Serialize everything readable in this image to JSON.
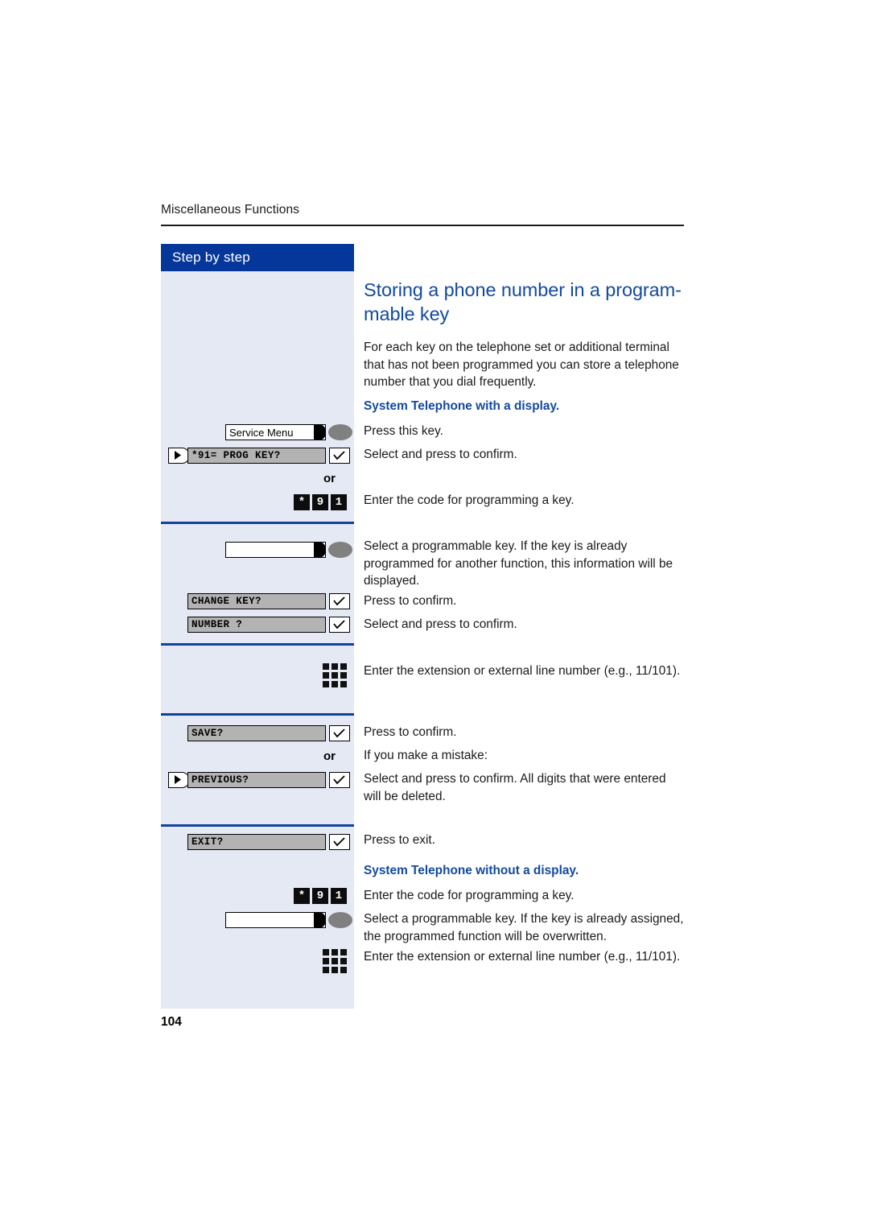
{
  "page": {
    "running_head": "Miscellaneous Functions",
    "folio": "104"
  },
  "sidebar": {
    "header_label": "Step by step",
    "sections": [
      {
        "name": "service-menu-section",
        "rows": [
          {
            "type": "function-key",
            "name": "service-menu-key",
            "label": "Service Menu"
          },
          {
            "type": "display-line",
            "name": "prog-key-display-line",
            "has_arrow": true,
            "text": "*91= PROG KEY?",
            "confirm": true
          },
          {
            "type": "or",
            "name": "or-marker-1",
            "label": "or"
          },
          {
            "type": "dial-keys",
            "name": "code-91-keys",
            "keys": [
              "*",
              "9",
              "1"
            ]
          }
        ]
      },
      {
        "name": "select-key-section",
        "rows": [
          {
            "type": "function-key",
            "name": "programmable-key",
            "label": ""
          },
          {
            "type": "display-line",
            "name": "change-key-display-line",
            "has_arrow": false,
            "text": "CHANGE KEY?",
            "confirm": true
          },
          {
            "type": "display-line",
            "name": "number-display-line",
            "has_arrow": false,
            "text": "NUMBER ?",
            "confirm": true
          }
        ]
      },
      {
        "name": "enter-number-section",
        "rows": [
          {
            "type": "keypad",
            "name": "keypad-icon"
          }
        ]
      },
      {
        "name": "save-section",
        "rows": [
          {
            "type": "display-line",
            "name": "save-display-line",
            "has_arrow": false,
            "text": "SAVE?",
            "confirm": true
          },
          {
            "type": "or",
            "name": "or-marker-2",
            "label": "or"
          },
          {
            "type": "display-line",
            "name": "previous-display-line",
            "has_arrow": true,
            "text": "PREVIOUS?",
            "confirm": true
          }
        ]
      },
      {
        "name": "exit-section",
        "rows": [
          {
            "type": "display-line",
            "name": "exit-display-line",
            "has_arrow": false,
            "text": "EXIT?",
            "confirm": true
          },
          {
            "type": "dial-keys",
            "name": "code-91-keys-2",
            "keys": [
              "*",
              "9",
              "1"
            ]
          },
          {
            "type": "function-key",
            "name": "programmable-key-2",
            "label": ""
          },
          {
            "type": "keypad",
            "name": "keypad-icon-2"
          }
        ]
      }
    ],
    "lcd_texts": {
      "prog_key": "*91= PROG KEY?",
      "change_key": "CHANGE KEY?",
      "number": "NUMBER ?",
      "save": "SAVE?",
      "previous": "PREVIOUS?",
      "exit": "EXIT?"
    },
    "service_menu_label": "Service Menu",
    "or_label": "or",
    "dial_keys": {
      "star": "*",
      "nine": "9",
      "one": "1"
    }
  },
  "content": {
    "title": "Storing a phone number in a program-\nmable key",
    "intro": "For each key on the telephone set or additional terminal that has not been programmed you can store a telephone number that you dial frequently.",
    "subhead_with_display": "System Telephone with a display.",
    "subhead_without_display": "System Telephone without a display.",
    "steps": {
      "press_this_key": "Press this key.",
      "select_confirm_1": "Select and press to confirm.",
      "enter_code": "Enter the code for programming a key.",
      "select_prog_key": "Select a programmable key. If the key is already programmed for another function, this information will be displayed.",
      "press_confirm_1": "Press to confirm.",
      "select_confirm_2": "Select and press to confirm.",
      "enter_extension_1": "Enter the extension or external line number (e.g., 11/101).",
      "press_confirm_2": "Press to confirm.",
      "if_mistake": "If you make a mistake:",
      "select_confirm_delete": "Select and press to confirm. All digits that were entered will be deleted.",
      "press_exit": "Press to exit.",
      "enter_code_2": "Enter the code for programming a key.",
      "select_prog_key_2": "Select a programmable key. If the key is already assigned, the programmed function will be overwritten.",
      "enter_extension_2": "Enter the extension or external line number (e.g., 11/101)."
    }
  },
  "colors": {
    "accent_blue": "#12499f",
    "header_blue": "#05379b",
    "sidebar_bg": "#e4e9f4",
    "rule_blue": "#10429e",
    "lcd_gray": "#b3b3b3",
    "led_gray": "#808080"
  }
}
